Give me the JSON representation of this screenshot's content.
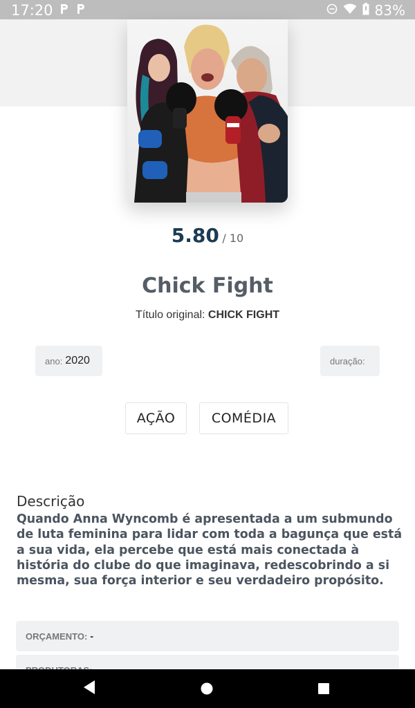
{
  "status_bar": {
    "time": "17:20",
    "battery": "83%",
    "icons": [
      "parking-p-icon",
      "parking-p-icon",
      "dnd-icon",
      "wifi-icon",
      "battery-icon"
    ]
  },
  "poster": {
    "alt": "Chick Fight poster"
  },
  "rating": {
    "value": "5.80",
    "max": "/ 10"
  },
  "movie": {
    "title": "Chick Fight",
    "original_label": "Título original:",
    "original_title": "CHICK FIGHT"
  },
  "meta": {
    "year_label": "ano:",
    "year_value": "2020",
    "duration_label": "duração:",
    "duration_value": ""
  },
  "genres": [
    "AÇÃO",
    "COMÉDIA"
  ],
  "description": {
    "heading": "Descrição",
    "text": "Quando Anna Wyncomb é apresentada a um submundo de luta feminina para lidar com toda a bagunça que está a sua vida, ela percebe que está mais conectada à história do clube do que imaginava, redescobrindo a si mesma, sua força interior e seu verdadeiro propósito."
  },
  "info": [
    {
      "label": "ORÇAMENTO:",
      "value": "-"
    },
    {
      "label": "PRODUTORAS:",
      "value": ""
    }
  ],
  "colors": {
    "rating": "#1d3b52",
    "title": "#555d66",
    "pill_bg": "#f0f1f3",
    "status_bar": "#bdbdbd"
  }
}
